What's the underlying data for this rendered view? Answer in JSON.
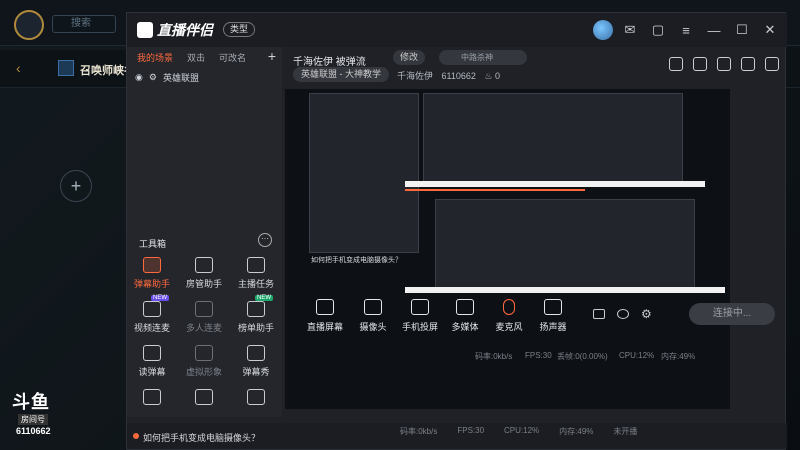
{
  "game": {
    "search_placeholder": "搜索",
    "mode_title": "召唤师峡谷",
    "douyu_logo": "斗鱼",
    "room_label": "房间号",
    "room_id": "6110662"
  },
  "app": {
    "title": "直播伴侣",
    "badge": "类型",
    "left": {
      "tabs": [
        {
          "label": "我的场景",
          "active": true
        },
        {
          "label": "双击",
          "active": false
        },
        {
          "label": "可改名",
          "active": false
        }
      ],
      "scene_name": "英雄联盟",
      "toolbox_title": "工具箱",
      "tools": [
        {
          "label": "弹幕助手",
          "icon": "danmaku-icon",
          "highlight": true,
          "tag": ""
        },
        {
          "label": "房管助手",
          "icon": "user-icon",
          "highlight": false,
          "tag": ""
        },
        {
          "label": "主播任务",
          "icon": "task-icon",
          "highlight": false,
          "tag": ""
        },
        {
          "label": "视频连麦",
          "icon": "video-link-icon",
          "highlight": false,
          "tag": "NEW"
        },
        {
          "label": "多人连麦",
          "icon": "multi-link-icon",
          "highlight": false,
          "tag": "",
          "dim": true
        },
        {
          "label": "榜单助手",
          "icon": "rank-icon",
          "highlight": false,
          "tag": "NEW"
        },
        {
          "label": "读弹幕",
          "icon": "read-danmaku-icon",
          "highlight": false,
          "tag": ""
        },
        {
          "label": "虚拟形象",
          "icon": "avatar-icon",
          "highlight": false,
          "tag": "",
          "dim": true
        },
        {
          "label": "弹幕秀",
          "icon": "danmaku-show-icon",
          "highlight": false,
          "tag": ""
        }
      ]
    },
    "right": {
      "room_title": "千海佐伊 被弹流",
      "edit_label": "修改",
      "tag_placeholder": "中路杀神",
      "category": "英雄联盟 - 大神教学",
      "room_info": "千海佐伊",
      "room_number": "6110662",
      "fans": "0"
    },
    "controls": [
      {
        "label": "直播屏幕",
        "icon": "screen-icon"
      },
      {
        "label": "摄像头",
        "icon": "camera-icon"
      },
      {
        "label": "手机投屏",
        "icon": "phone-cast-icon"
      },
      {
        "label": "多媒体",
        "icon": "media-icon"
      },
      {
        "label": "麦克风",
        "icon": "mic-icon"
      },
      {
        "label": "扬声器",
        "icon": "speaker-icon"
      }
    ],
    "start_button": "连接中...",
    "status": {
      "bitrate": "码率:0kb/s",
      "fps": "FPS:30",
      "drop": "丢帧:0(0.00%)",
      "cpu": "CPU:12%",
      "mem": "内存:49%"
    },
    "tip": "如何把手机变成电脑摄像头？"
  },
  "nested": {
    "tip": "如何把手机变成电脑摄像头？",
    "status_right": "未开播",
    "bottom_start": "连接中..."
  },
  "colors": {
    "accent": "#ff6a3d",
    "panel": "#24262c",
    "bg": "#1f2126"
  }
}
